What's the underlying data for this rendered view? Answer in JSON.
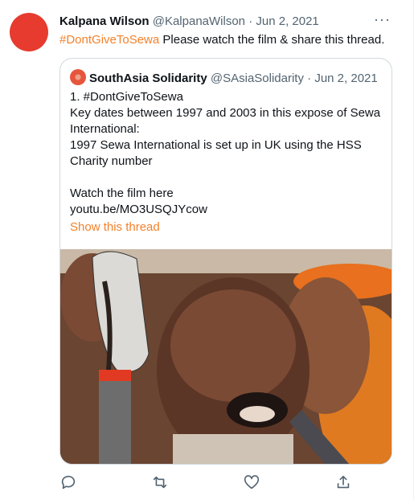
{
  "tweet": {
    "author_name": "Kalpana Wilson",
    "author_handle": "@KalpanaWilson",
    "separator": "·",
    "date": "Jun 2, 2021",
    "more_label": "···",
    "hashtag": "#DontGiveToSewa",
    "text_rest": " Please watch the film & share this thread."
  },
  "quote": {
    "author_name": "SouthAsia Solidarity",
    "author_handle": "@SAsiaSolidarity",
    "separator": "·",
    "date": "Jun 2, 2021",
    "lines": [
      "1. #DontGiveToSewa",
      "Key dates between 1997 and 2003 in this expose of Sewa",
      "International:",
      "1997 Sewa International is set up in UK using the HSS",
      "Charity number",
      "",
      "Watch the film here",
      "youtu.be/MO3USQJYcow"
    ],
    "show_thread": "Show this thread"
  },
  "actions": [
    "reply-icon",
    "retweet-icon",
    "like-icon",
    "share-icon"
  ],
  "colors": {
    "accent": "#f4812a",
    "avatar": "#e63b2e",
    "muted": "#536471",
    "border": "#cfd9de"
  }
}
